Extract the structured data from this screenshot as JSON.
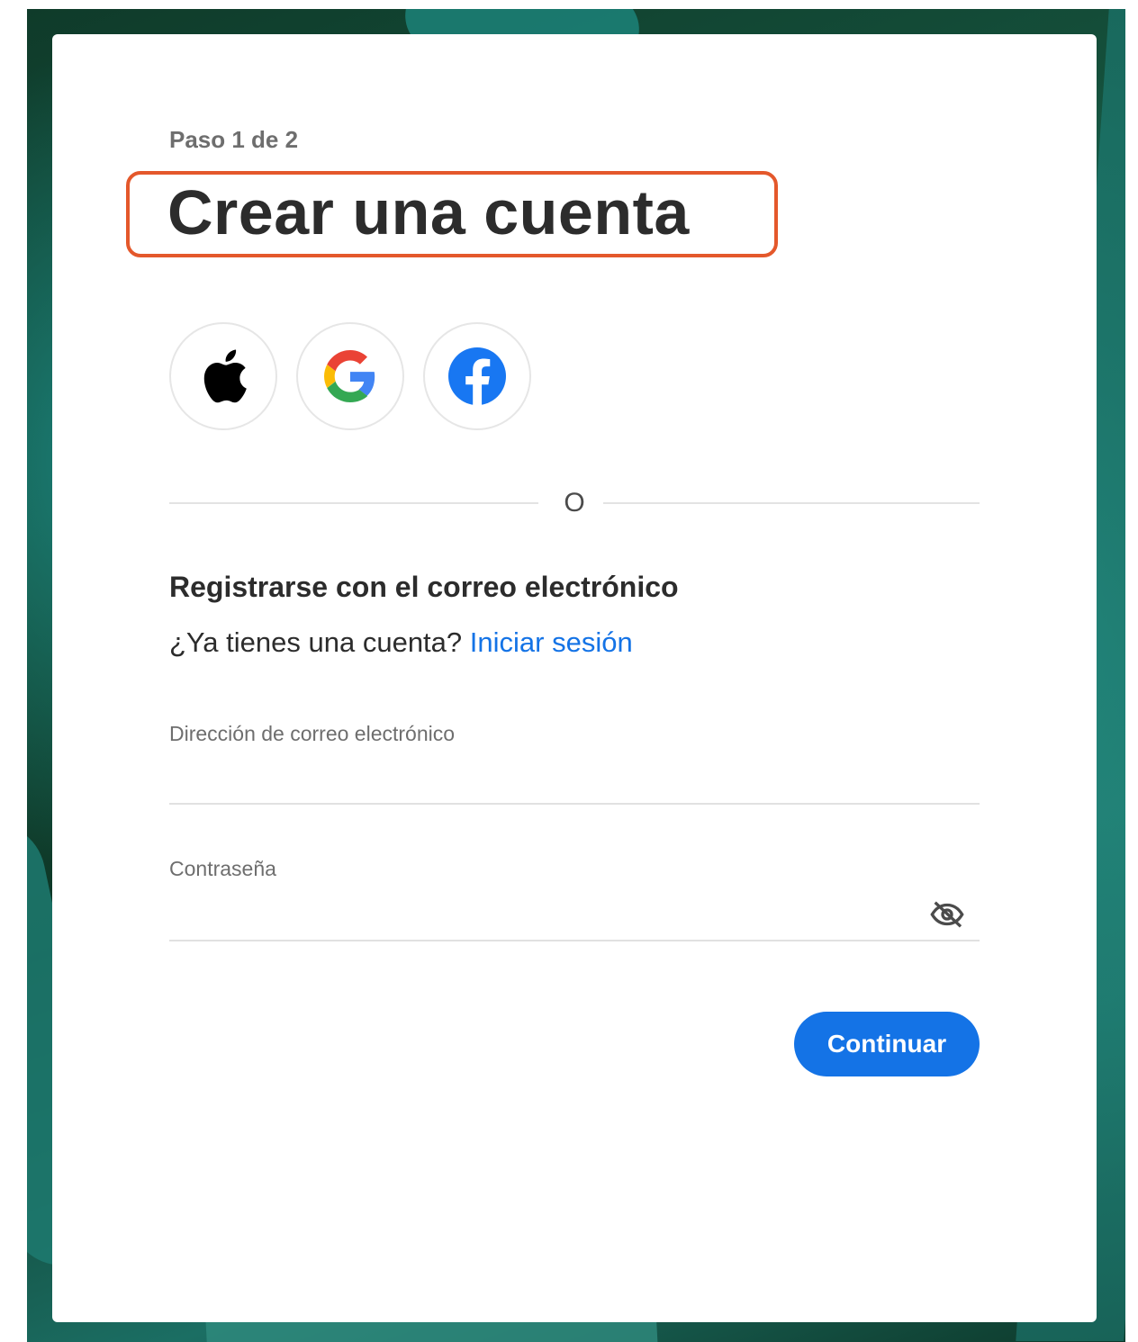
{
  "step_label": "Paso 1 de 2",
  "title": "Crear una cuenta",
  "social": [
    {
      "provider": "Apple",
      "icon": "apple-icon"
    },
    {
      "provider": "Google",
      "icon": "google-icon"
    },
    {
      "provider": "Facebook",
      "icon": "facebook-icon"
    }
  ],
  "divider_text": "O",
  "email_section": {
    "heading": "Registrarse con el correo electrónico",
    "have_account_text": "¿Ya tienes una cuenta?",
    "sign_in_link": "Iniciar sesión"
  },
  "form": {
    "email_label": "Dirección de correo electrónico",
    "email_value": "",
    "password_label": "Contraseña",
    "password_value": "",
    "password_toggle_icon": "eye-slash-icon"
  },
  "continue_button": "Continuar",
  "colors": {
    "accent": "#1473e6",
    "highlight_border": "#e4582b",
    "title_text": "#2c2c2c",
    "muted_text": "#6e6e6e"
  }
}
